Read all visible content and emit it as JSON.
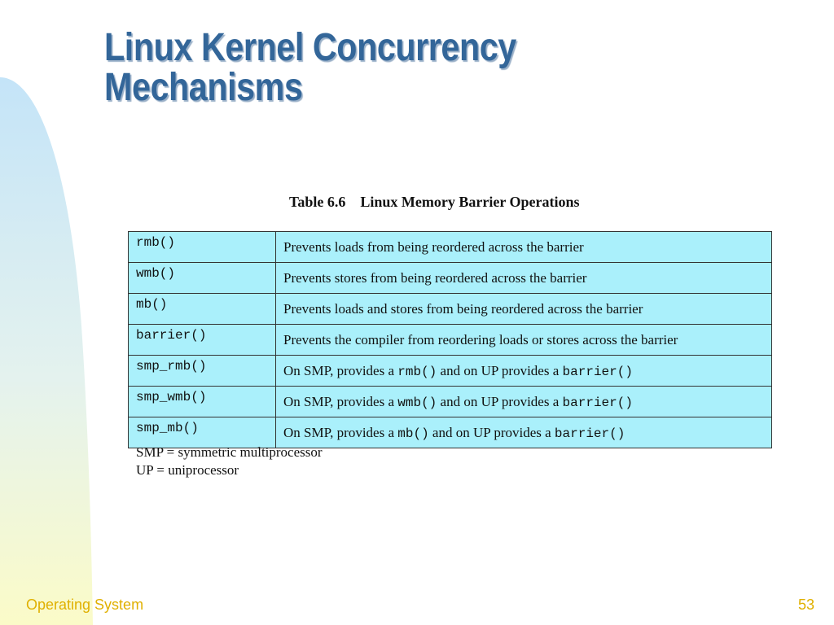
{
  "slide": {
    "title_line1": "Linux Kernel Concurrency",
    "title_line2": "Mechanisms",
    "footer_label": "Operating System",
    "page_number": "53"
  },
  "table": {
    "caption_number": "Table 6.6",
    "caption_title": "Linux Memory Barrier Operations",
    "rows": [
      {
        "op": "rmb()",
        "desc": "Prevents loads from being reordered across the barrier"
      },
      {
        "op": "wmb()",
        "desc": "Prevents stores from being reordered across the barrier"
      },
      {
        "op": "mb()",
        "desc": "Prevents loads and stores from being reordered across the barrier"
      },
      {
        "op": "barrier()",
        "desc": "Prevents the compiler from reordering loads or stores across the barrier"
      },
      {
        "op": "smp_rmb()",
        "desc_pre": "On SMP, provides a ",
        "desc_code1": "rmb()",
        "desc_mid": " and on UP provides a ",
        "desc_code2": "barrier()"
      },
      {
        "op": "smp_wmb()",
        "desc_pre": "On SMP, provides a ",
        "desc_code1": "wmb()",
        "desc_mid": " and on UP provides a ",
        "desc_code2": "barrier()"
      },
      {
        "op": "smp_mb()",
        "desc_pre": "On SMP, provides a ",
        "desc_code1": "mb()",
        "desc_mid": " and on UP provides a ",
        "desc_code2": "barrier()"
      }
    ]
  },
  "notes": {
    "smp": "SMP = symmetric multiprocessor",
    "up": "UP = uniprocessor"
  },
  "colors": {
    "title": "#336699",
    "table_fill": "#aaf0fb",
    "footer": "#e0b000"
  }
}
